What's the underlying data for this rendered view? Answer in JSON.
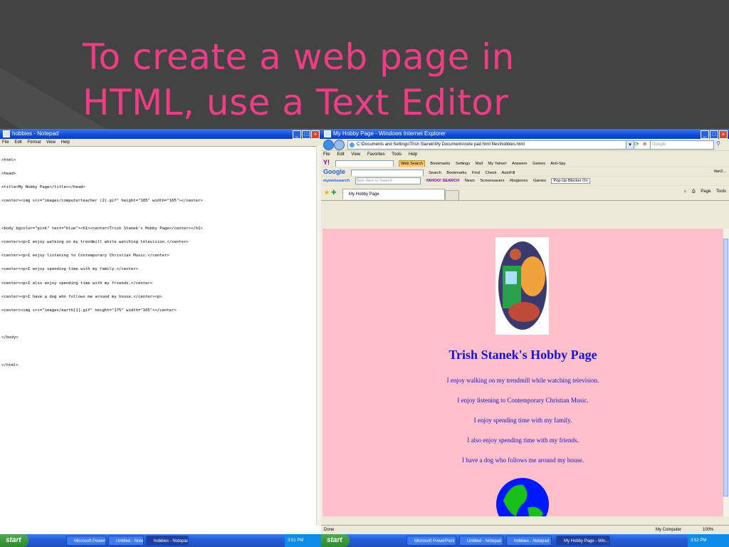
{
  "slide": {
    "title_line1": "To create a web page in",
    "title_line2": "HTML, use a Text Editor"
  },
  "notepad": {
    "window_title": "hobbies - Notepad",
    "menu": [
      "File",
      "Edit",
      "Format",
      "View",
      "Help"
    ],
    "lines": [
      "<html>",
      "<head>",
      "<title>My Hobby Page</title></head>",
      "<center><img src=\"images/computerteacher (2).gif\" height=\"185\" width=\"165\"></center>",
      "",
      "<body bgcolor=\"pink\" text=\"blue\"><h1><center>Trish Stanek's Hobby Page</center></h1>",
      "<center><p>I enjoy walking on my trendmill while watching television.</center>",
      "<center><p>I enjoy listening to Contemporary Christian Music.</center>",
      "<center><p>I enjoy spending time with my family.</center>",
      "<center><p>I also enjoy spending time with my friends.</center>",
      "<center><p>I have a dog who follows me around my house.</center><p>",
      "<center><img src=\"images/earth[1].gif\" height=\"175\" width=\"165\"></center>",
      "",
      "</body>",
      "",
      "</html>"
    ]
  },
  "ie": {
    "window_title": "My Hobby Page - Windows Internet Explorer",
    "address": "C:\\Documents and Settings\\Trish Stanek\\My Documents\\note pad html files\\hobbies.html",
    "search_placeholder": "Google",
    "menu": [
      "File",
      "Edit",
      "View",
      "Favorites",
      "Tools",
      "Help"
    ],
    "toolbar_yahoo": {
      "brand": "Y!",
      "web_search": "Web Search",
      "items": [
        "Bookmarks",
        "Settings",
        "Mail",
        "My Yahoo!",
        "Answers",
        "Games",
        "Anti-Spy"
      ]
    },
    "toolbar_google": {
      "brand": "Google",
      "items": [
        "Search",
        "Bookmarks",
        "Find",
        "Check",
        "AutoFill"
      ],
      "user": "tfan2..."
    },
    "toolbar_mws": {
      "brand": "mywebsearch",
      "placeholder": "Type Here to Search",
      "yahoo_label": "YAHOO! SEARCH",
      "items": [
        "News",
        "Screensavers",
        "Ringtones",
        "Games"
      ],
      "popup": "Pop-Up Blocker On"
    },
    "tab_label": "My Hobby Page",
    "tab_tools": [
      "Page",
      "Tools"
    ],
    "page": {
      "heading": "Trish Stanek's Hobby Page",
      "lines": [
        "I enjoy walking on my trendmill while watching television.",
        "I enjoy listening to Contemporary Christian Music.",
        "I enjoy spending time with my family.",
        "I also enjoy spending time with my friends.",
        "I have a dog who follows me around my house."
      ]
    },
    "status_left": "Done",
    "status_zone": "My Computer",
    "status_zoom": "100%"
  },
  "taskbar_left": {
    "start": "start",
    "tasks": [
      "Microsoft PowerPoint ...",
      "Untitled - Notepad",
      "hobbies - Notepad"
    ],
    "clock": "3:51 PM"
  },
  "taskbar_right": {
    "start": "start",
    "tasks": [
      "Microsoft PowerPoint ...",
      "Untitled - Notepad",
      "hobbies - Notepad",
      "My Hobby Page - Win..."
    ],
    "clock": "3:52 PM"
  }
}
